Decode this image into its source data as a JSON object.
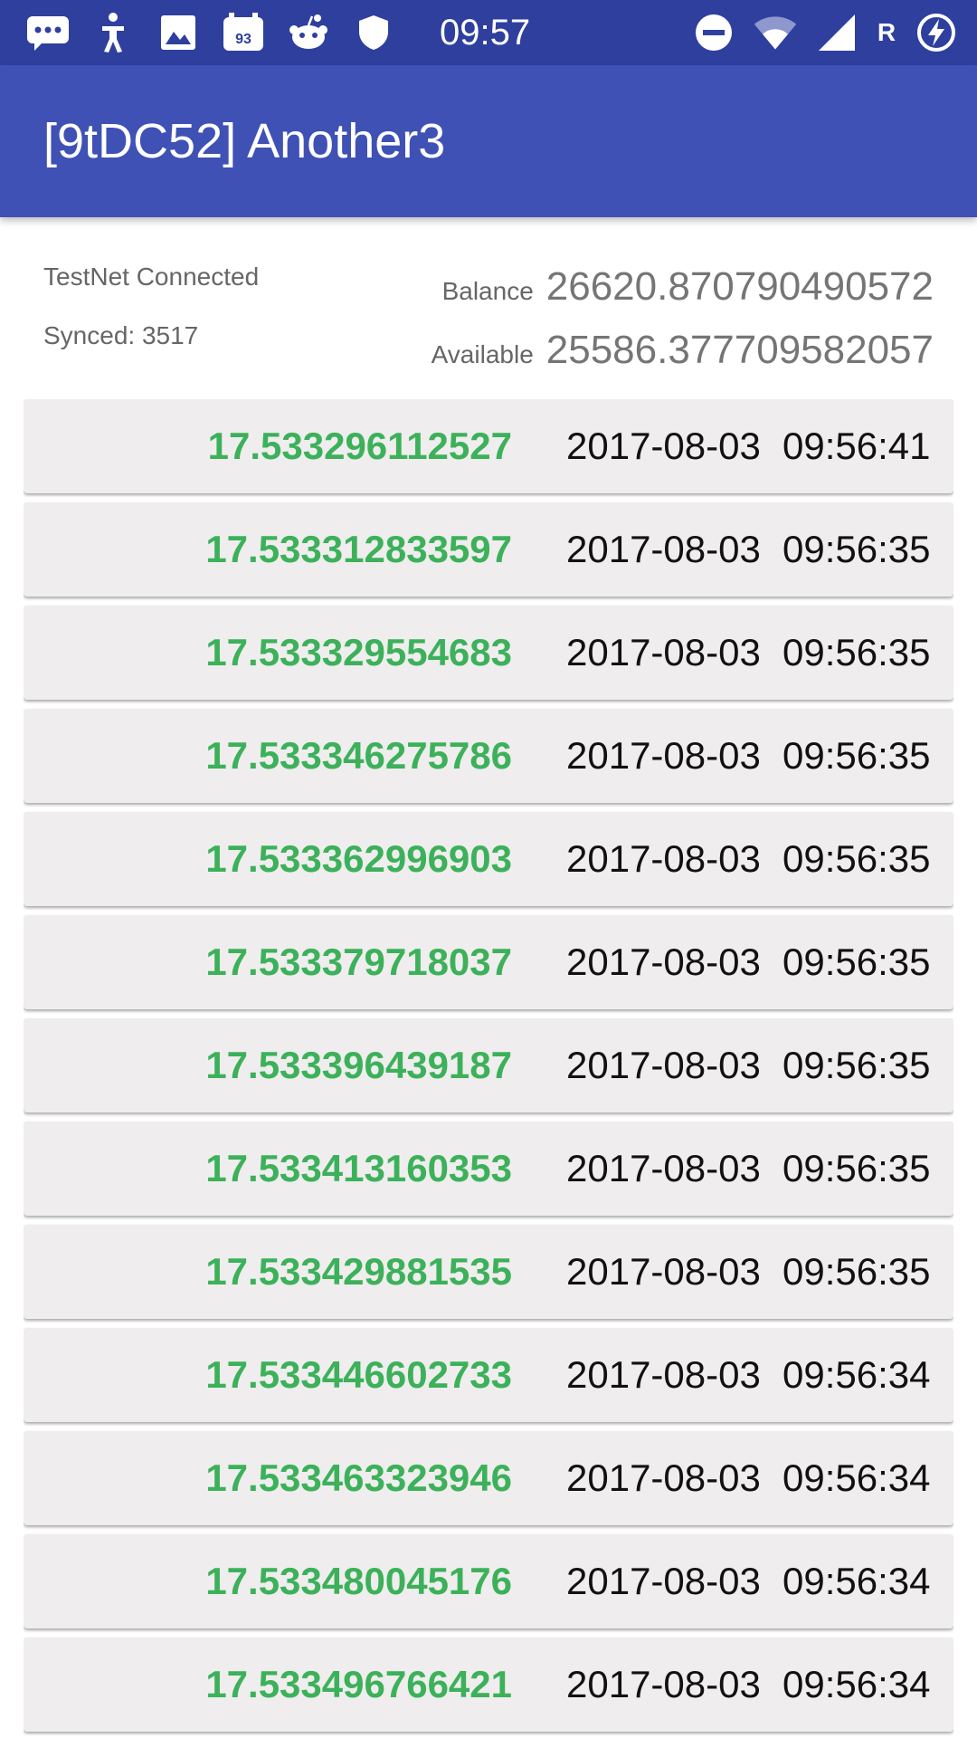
{
  "status_bar": {
    "time": "09:57",
    "badge_number": "93",
    "network_label": "R",
    "icons_left": [
      "message-icon",
      "accessibility-icon",
      "image-icon",
      "calendar-badge-icon",
      "reddit-icon",
      "shield-icon"
    ],
    "icons_right": [
      "do-not-disturb-icon",
      "wifi-icon",
      "signal-icon",
      "battery-charging-icon"
    ]
  },
  "app_bar": {
    "title": "[9tDC52] Another3",
    "color": "#3f51b5"
  },
  "wallet": {
    "connection_status": "TestNet Connected",
    "synced": "Synced: 3517",
    "balance_label": "Balance",
    "balance_value": "26620.870790490572",
    "available_label": "Available",
    "available_value": "25586.377709582057"
  },
  "colors": {
    "amount_positive": "#3cb15a",
    "status_bar": "#2f3f9e"
  },
  "transactions": [
    {
      "amount": "17.533296112527",
      "date": "2017-08-03",
      "time": "09:56:41"
    },
    {
      "amount": "17.533312833597",
      "date": "2017-08-03",
      "time": "09:56:35"
    },
    {
      "amount": "17.533329554683",
      "date": "2017-08-03",
      "time": "09:56:35"
    },
    {
      "amount": "17.533346275786",
      "date": "2017-08-03",
      "time": "09:56:35"
    },
    {
      "amount": "17.533362996903",
      "date": "2017-08-03",
      "time": "09:56:35"
    },
    {
      "amount": "17.533379718037",
      "date": "2017-08-03",
      "time": "09:56:35"
    },
    {
      "amount": "17.533396439187",
      "date": "2017-08-03",
      "time": "09:56:35"
    },
    {
      "amount": "17.533413160353",
      "date": "2017-08-03",
      "time": "09:56:35"
    },
    {
      "amount": "17.533429881535",
      "date": "2017-08-03",
      "time": "09:56:35"
    },
    {
      "amount": "17.533446602733",
      "date": "2017-08-03",
      "time": "09:56:34"
    },
    {
      "amount": "17.533463323946",
      "date": "2017-08-03",
      "time": "09:56:34"
    },
    {
      "amount": "17.533480045176",
      "date": "2017-08-03",
      "time": "09:56:34"
    },
    {
      "amount": "17.533496766421",
      "date": "2017-08-03",
      "time": "09:56:34"
    }
  ]
}
